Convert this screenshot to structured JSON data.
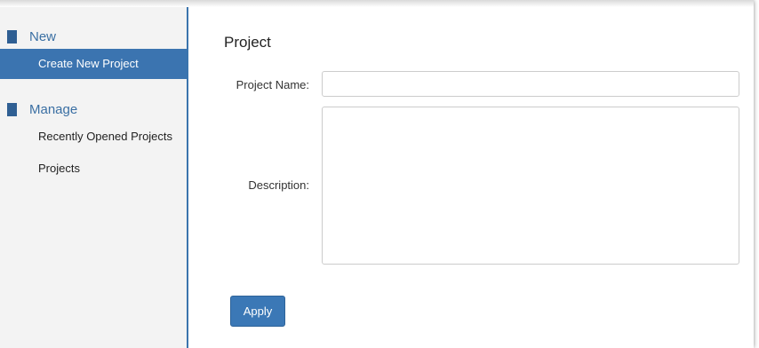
{
  "sidebar": {
    "sections": [
      {
        "title": "New",
        "items": [
          {
            "label": "Create New Project",
            "active": true
          }
        ]
      },
      {
        "title": "Manage",
        "items": [
          {
            "label": "Recently Opened Projects",
            "active": false
          },
          {
            "label": "Projects",
            "active": false
          }
        ]
      }
    ]
  },
  "main": {
    "title": "Project",
    "project_name": {
      "label": "Project Name:",
      "value": "",
      "placeholder": ""
    },
    "description": {
      "label": "Description:",
      "value": "",
      "placeholder": ""
    },
    "apply_label": "Apply"
  },
  "colors": {
    "accent": "#3b74b0",
    "section_text": "#3a6fa3",
    "sidebar_bg": "#f3f3f3",
    "button": "#3b78b6"
  }
}
